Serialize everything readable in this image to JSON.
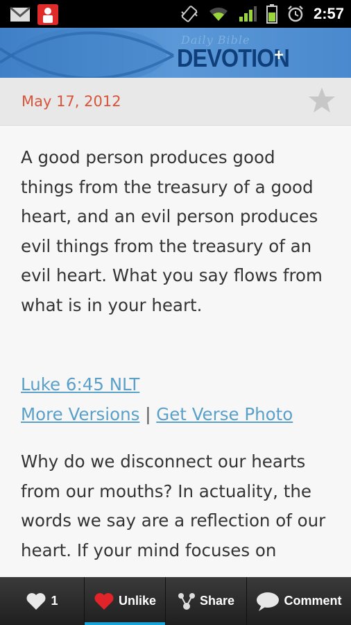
{
  "status_bar": {
    "time": "2:57",
    "icons": [
      "gmail-icon",
      "notification-app-icon",
      "vibrate-icon",
      "wifi-icon",
      "signal-icon",
      "battery-icon",
      "alarm-icon"
    ]
  },
  "header": {
    "brand_small": "Daily Bible",
    "brand_big": "DEVOTION",
    "brand_plus": "+"
  },
  "date_bar": {
    "date": "May 17, 2012",
    "favorite_icon": "star-icon"
  },
  "content": {
    "verse_text": "A good person produces good things from the treasury of a good heart, and an evil person produces evil things from the treasury of an evil heart. What you say flows from what is in your heart.",
    "reference_link": "Luke 6:45 NLT",
    "more_versions_link": "More Versions",
    "separator": "|",
    "verse_photo_link": "Get Verse Photo",
    "devotion_text": "Why do we disconnect our hearts from our mouths? In actuality, the words we say are a reflection of our heart. If your mind focuses on"
  },
  "bottom_bar": {
    "like_count": "1",
    "unlike_label": "Unlike",
    "share_label": "Share",
    "comment_label": "Comment"
  },
  "colors": {
    "date": "#d9543a",
    "link": "#5aa0c8",
    "header_blue": "#4a89cd",
    "tab_accent": "#17a3d8",
    "heart_red": "#e0242a"
  }
}
